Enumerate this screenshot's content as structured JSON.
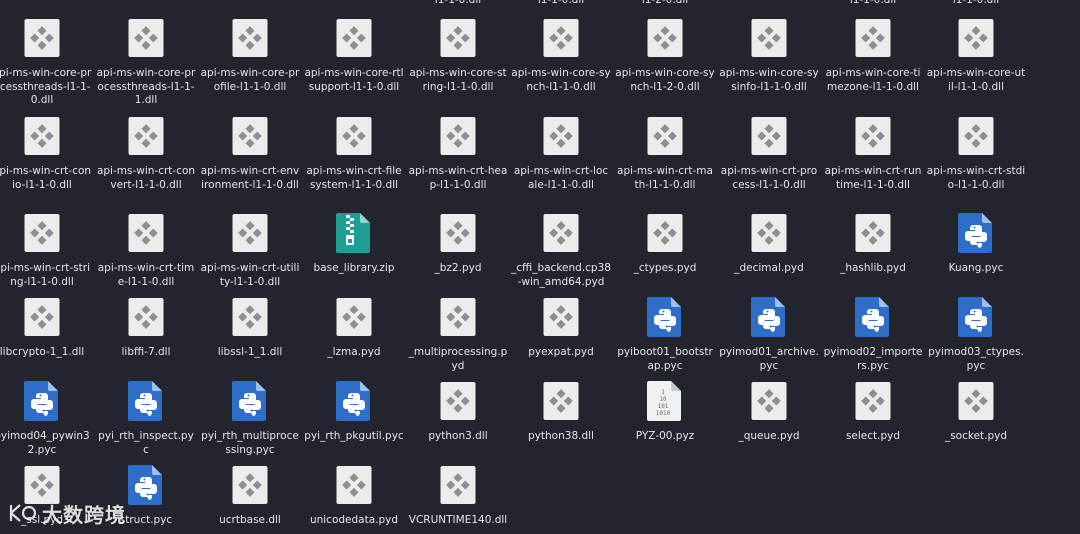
{
  "colors": {
    "background": "#23252e",
    "label_text": "#e6e6e8",
    "python_blue": "#2f6ec8",
    "zip_teal": "#1f9e94",
    "generic_gray": "#dddddd"
  },
  "top_partial_labels": [
    "l1-1-0.dll",
    "l1-1-0.dll",
    "l1-2-0.dll",
    "l1-1-0.dll",
    "l1-1-0.dll"
  ],
  "rows": [
    [
      {
        "label": "api-ms-win-core-processthreads-l1-1-0.dll",
        "icon": "generic-file-icon"
      },
      {
        "label": "api-ms-win-core-processthreads-l1-1-1.dll",
        "icon": "generic-file-icon"
      },
      {
        "label": "api-ms-win-core-profile-l1-1-0.dll",
        "icon": "generic-file-icon"
      },
      {
        "label": "api-ms-win-core-rtlsupport-l1-1-0.dll",
        "icon": "generic-file-icon"
      },
      {
        "label": "api-ms-win-core-string-l1-1-0.dll",
        "icon": "generic-file-icon"
      },
      {
        "label": "api-ms-win-core-synch-l1-1-0.dll",
        "icon": "generic-file-icon"
      },
      {
        "label": "api-ms-win-core-synch-l1-2-0.dll",
        "icon": "generic-file-icon"
      },
      {
        "label": "api-ms-win-core-sysinfo-l1-1-0.dll",
        "icon": "generic-file-icon"
      },
      {
        "label": "api-ms-win-core-timezone-l1-1-0.dll",
        "icon": "generic-file-icon"
      },
      {
        "label": "api-ms-win-core-util-l1-1-0.dll",
        "icon": "generic-file-icon"
      }
    ],
    [
      {
        "label": "api-ms-win-crt-conio-l1-1-0.dll",
        "icon": "generic-file-icon"
      },
      {
        "label": "api-ms-win-crt-convert-l1-1-0.dll",
        "icon": "generic-file-icon"
      },
      {
        "label": "api-ms-win-crt-environment-l1-1-0.dll",
        "icon": "generic-file-icon"
      },
      {
        "label": "api-ms-win-crt-filesystem-l1-1-0.dll",
        "icon": "generic-file-icon"
      },
      {
        "label": "api-ms-win-crt-heap-l1-1-0.dll",
        "icon": "generic-file-icon"
      },
      {
        "label": "api-ms-win-crt-locale-l1-1-0.dll",
        "icon": "generic-file-icon"
      },
      {
        "label": "api-ms-win-crt-math-l1-1-0.dll",
        "icon": "generic-file-icon"
      },
      {
        "label": "api-ms-win-crt-process-l1-1-0.dll",
        "icon": "generic-file-icon"
      },
      {
        "label": "api-ms-win-crt-runtime-l1-1-0.dll",
        "icon": "generic-file-icon"
      },
      {
        "label": "api-ms-win-crt-stdio-l1-1-0.dll",
        "icon": "generic-file-icon"
      }
    ],
    [
      {
        "label": "api-ms-win-crt-string-l1-1-0.dll",
        "icon": "generic-file-icon"
      },
      {
        "label": "api-ms-win-crt-time-l1-1-0.dll",
        "icon": "generic-file-icon"
      },
      {
        "label": "api-ms-win-crt-utility-l1-1-0.dll",
        "icon": "generic-file-icon"
      },
      {
        "label": "base_library.zip",
        "icon": "zip-archive-icon"
      },
      {
        "label": "_bz2.pyd",
        "icon": "generic-file-icon"
      },
      {
        "label": "_cffi_backend.cp38-win_amd64.pyd",
        "icon": "generic-file-icon"
      },
      {
        "label": "_ctypes.pyd",
        "icon": "generic-file-icon"
      },
      {
        "label": "_decimal.pyd",
        "icon": "generic-file-icon"
      },
      {
        "label": "_hashlib.pyd",
        "icon": "generic-file-icon"
      },
      {
        "label": "Kuang.pyc",
        "icon": "python-file-icon"
      }
    ],
    [
      {
        "label": "libcrypto-1_1.dll",
        "icon": "generic-file-icon"
      },
      {
        "label": "libffi-7.dll",
        "icon": "generic-file-icon"
      },
      {
        "label": "libssl-1_1.dll",
        "icon": "generic-file-icon"
      },
      {
        "label": "_lzma.pyd",
        "icon": "generic-file-icon"
      },
      {
        "label": "_multiprocessing.pyd",
        "icon": "generic-file-icon"
      },
      {
        "label": "pyexpat.pyd",
        "icon": "generic-file-icon"
      },
      {
        "label": "pyiboot01_bootstrap.pyc",
        "icon": "python-file-icon"
      },
      {
        "label": "pyimod01_archive.pyc",
        "icon": "python-file-icon"
      },
      {
        "label": "pyimod02_importers.pyc",
        "icon": "python-file-icon"
      },
      {
        "label": "pyimod03_ctypes.pyc",
        "icon": "python-file-icon"
      }
    ],
    [
      {
        "label": "pyimod04_pywin32.pyc",
        "icon": "python-file-icon"
      },
      {
        "label": "pyi_rth_inspect.pyc",
        "icon": "python-file-icon"
      },
      {
        "label": "pyi_rth_multiprocessing.pyc",
        "icon": "python-file-icon"
      },
      {
        "label": "pyi_rth_pkgutil.pyc",
        "icon": "python-file-icon"
      },
      {
        "label": "python3.dll",
        "icon": "generic-file-icon"
      },
      {
        "label": "python38.dll",
        "icon": "generic-file-icon"
      },
      {
        "label": "PYZ-00.pyz",
        "icon": "binary-file-icon"
      },
      {
        "label": "_queue.pyd",
        "icon": "generic-file-icon"
      },
      {
        "label": "select.pyd",
        "icon": "generic-file-icon"
      },
      {
        "label": "_socket.pyd",
        "icon": "generic-file-icon"
      }
    ],
    [
      {
        "label": "_ssl.pyd",
        "icon": "generic-file-icon"
      },
      {
        "label": "struct.pyc",
        "icon": "python-file-icon"
      },
      {
        "label": "ucrtbase.dll",
        "icon": "generic-file-icon"
      },
      {
        "label": "unicodedata.pyd",
        "icon": "generic-file-icon"
      },
      {
        "label": "VCRUNTIME140.dll",
        "icon": "generic-file-icon"
      }
    ]
  ],
  "watermark": {
    "text": "大数跨境"
  }
}
